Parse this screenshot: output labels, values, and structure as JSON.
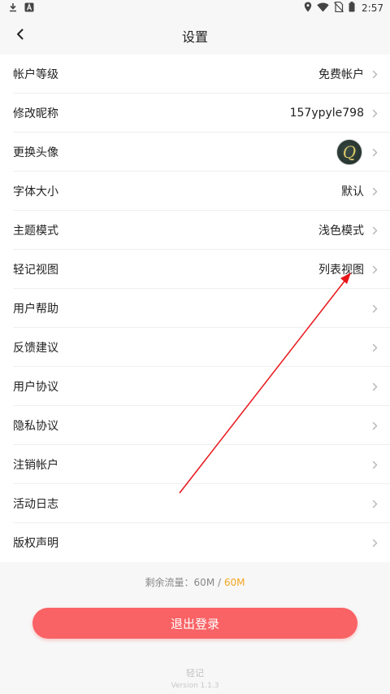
{
  "status_bar": {
    "time": "2:57",
    "icons": [
      "download-icon",
      "a-box-icon",
      "location-icon",
      "wifi-icon",
      "sim-off-icon",
      "battery-icon"
    ]
  },
  "nav": {
    "back_icon": "chevron-left-icon",
    "title": "设置"
  },
  "settings": {
    "items": [
      {
        "label": "帐户等级",
        "value": "免费帐户"
      },
      {
        "label": "修改昵称",
        "value": "157ypyle798"
      },
      {
        "label": "更换头像",
        "value": "",
        "avatar_letter": "Q"
      },
      {
        "label": "字体大小",
        "value": "默认"
      },
      {
        "label": "主题模式",
        "value": "浅色模式"
      },
      {
        "label": "轻记视图",
        "value": "列表视图"
      },
      {
        "label": "用户帮助",
        "value": ""
      },
      {
        "label": "反馈建议",
        "value": ""
      },
      {
        "label": "用户协议",
        "value": ""
      },
      {
        "label": "隐私协议",
        "value": ""
      },
      {
        "label": "注销帐户",
        "value": ""
      },
      {
        "label": "活动日志",
        "value": ""
      },
      {
        "label": "版权声明",
        "value": ""
      }
    ]
  },
  "traffic": {
    "prefix": "剩余流量：",
    "remaining": "60M",
    "separator": " / ",
    "total": "60M"
  },
  "logout_label": "退出登录",
  "app": {
    "name": "轻记",
    "version": "Version 1.1.3"
  },
  "colors": {
    "accent": "#fa6366",
    "traffic_total": "#f5a623",
    "annotation_arrow": "#e8141a"
  }
}
